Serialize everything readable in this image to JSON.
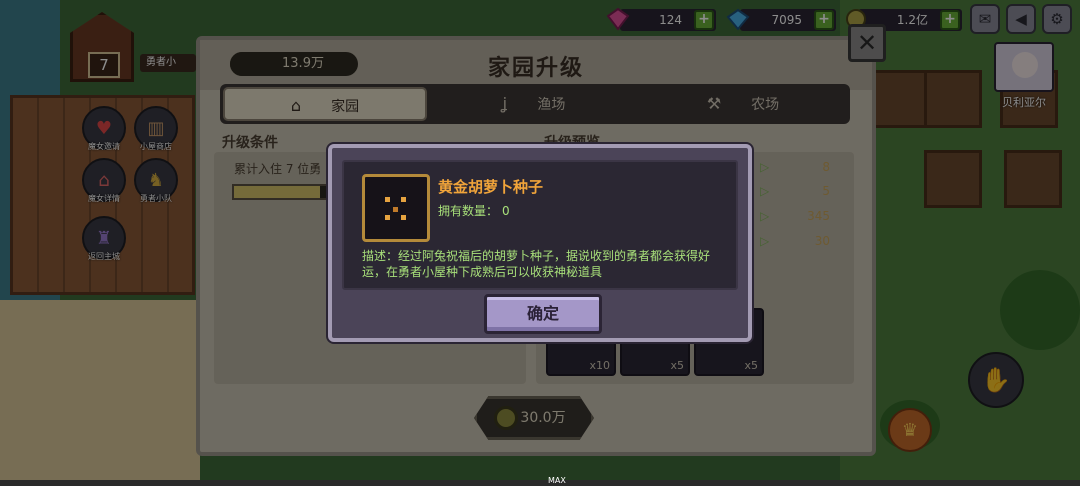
{
  "hud": {
    "hut_level": "7",
    "hero_tag": "勇者小",
    "menu": [
      {
        "label": "魔女邀请"
      },
      {
        "label": "小屋商店"
      },
      {
        "label": "魔女详情"
      },
      {
        "label": "勇者小队"
      },
      {
        "label": "返回主城"
      }
    ]
  },
  "resources": {
    "gems": "124",
    "diamonds": "7095",
    "gold": "1.2亿",
    "plus": "+"
  },
  "character_name": "贝利亚尔",
  "panel": {
    "title": "家园升级",
    "coins": "13.9万",
    "close": "✕",
    "tabs": [
      "家园",
      "渔场",
      "农场"
    ],
    "section_condition": "升级条件",
    "section_preview": "升级预览",
    "condition_text": "累计入住 7 位勇",
    "condition_progress": 0.9,
    "preview_values": [
      "8",
      "5",
      "345",
      "30"
    ],
    "item_quantities": [
      "x10",
      "x5",
      "x5"
    ],
    "upgrade_cost": "30.0万"
  },
  "modal": {
    "item_name": "黄金胡萝卜种子",
    "owned_label": "拥有数量：",
    "owned_value": "0",
    "description": "描述：经过阿兔祝福后的胡萝卜种子，据说收到的勇者都会获得好运，在勇者小屋种下成熟后可以收获神秘道具",
    "confirm": "确定"
  },
  "bottom_label": "MAX",
  "colors": {
    "item_name": "#f0a43a",
    "desc_text": "#a8e07a",
    "modal_bg": "#4b4458",
    "confirm_bg": "#a497c8"
  }
}
